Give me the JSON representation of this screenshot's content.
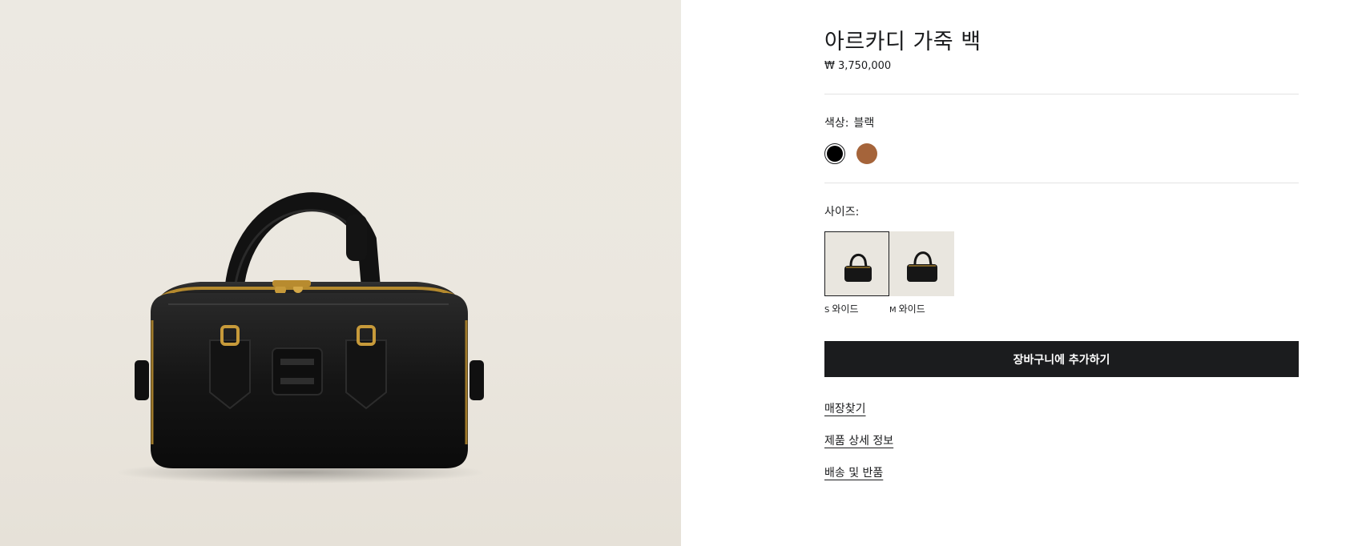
{
  "product": {
    "title": "아르카디 가죽 백",
    "price": "₩ 3,750,000",
    "image_alt_icon": "handbag-image"
  },
  "color": {
    "label": "색상:",
    "selected_value": "블랙",
    "options": [
      {
        "name": "black-swatch",
        "hex": "#000000",
        "selected": true
      },
      {
        "name": "brown-swatch",
        "hex": "#a5643a",
        "selected": false
      }
    ]
  },
  "size": {
    "label": "사이즈:",
    "options": [
      {
        "code": "S",
        "label": "와이드",
        "selected": true
      },
      {
        "code": "M",
        "label": "와이드",
        "selected": false
      }
    ]
  },
  "actions": {
    "add_to_cart": "장바구니에 추가하기"
  },
  "links": {
    "find_store": "매장찾기",
    "product_details": "제품 상세 정보",
    "shipping_returns": "배송 및 반품"
  },
  "colors": {
    "button_bg": "#1b1c1e",
    "gallery_bg": "#ebe7df",
    "text": "#1b1c1e"
  }
}
